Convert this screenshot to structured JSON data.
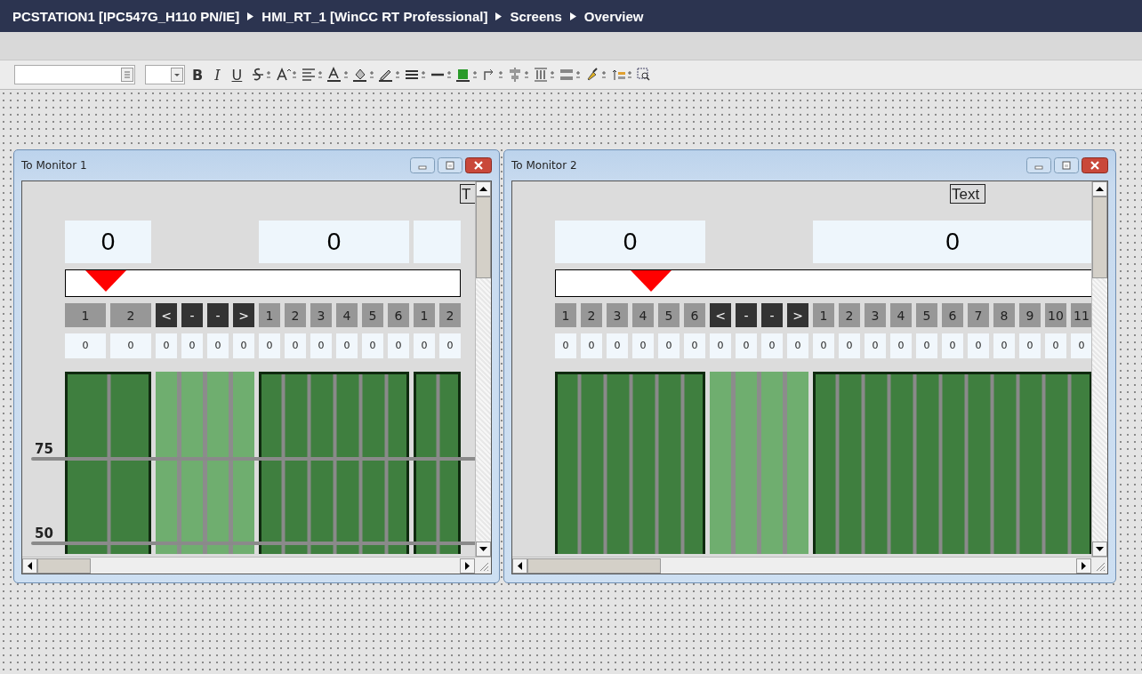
{
  "breadcrumb": [
    {
      "label": "PCSTATION1 [IPC547G_H110 PN/IE]"
    },
    {
      "label": "HMI_RT_1 [WinCC RT Professional]"
    },
    {
      "label": "Screens"
    },
    {
      "label": "Overview"
    }
  ],
  "toolbar": {
    "format_buttons": [
      "B",
      "I",
      "U"
    ]
  },
  "windows": [
    {
      "title": "To Monitor 1",
      "text_box": "T",
      "slider": {
        "level": 0.05
      },
      "scale_labels": [
        "75",
        "50"
      ],
      "groups": [
        {
          "kind": "wide",
          "display": "0",
          "cells": [
            {
              "label": "1",
              "value": "0"
            },
            {
              "label": "2",
              "value": "0"
            }
          ]
        },
        {
          "kind": "nav",
          "cells": [
            {
              "label": "<",
              "value": "0"
            },
            {
              "label": "-",
              "value": "0"
            },
            {
              "label": "-",
              "value": "0"
            },
            {
              "label": ">",
              "value": "0"
            }
          ]
        },
        {
          "kind": "slot",
          "display": "0",
          "cells": [
            {
              "label": "1",
              "value": "0"
            },
            {
              "label": "2",
              "value": "0"
            },
            {
              "label": "3",
              "value": "0"
            },
            {
              "label": "4",
              "value": "0"
            },
            {
              "label": "5",
              "value": "0"
            },
            {
              "label": "6",
              "value": "0"
            }
          ]
        },
        {
          "kind": "slot",
          "cells": [
            {
              "label": "1",
              "value": "0"
            },
            {
              "label": "2",
              "value": "0"
            }
          ]
        }
      ]
    },
    {
      "title": "To Monitor 2",
      "text_box": "Text",
      "slider": {
        "level": 0.14
      },
      "groups": [
        {
          "kind": "slot",
          "display": "0",
          "cells": [
            {
              "label": "1",
              "value": "0"
            },
            {
              "label": "2",
              "value": "0"
            },
            {
              "label": "3",
              "value": "0"
            },
            {
              "label": "4",
              "value": "0"
            },
            {
              "label": "5",
              "value": "0"
            },
            {
              "label": "6",
              "value": "0"
            }
          ]
        },
        {
          "kind": "nav",
          "cells": [
            {
              "label": "<",
              "value": "0"
            },
            {
              "label": "-",
              "value": "0"
            },
            {
              "label": "-",
              "value": "0"
            },
            {
              "label": ">",
              "value": "0"
            }
          ]
        },
        {
          "kind": "slot",
          "display": "0",
          "cells": [
            {
              "label": "1",
              "value": "0"
            },
            {
              "label": "2",
              "value": "0"
            },
            {
              "label": "3",
              "value": "0"
            },
            {
              "label": "4",
              "value": "0"
            },
            {
              "label": "5",
              "value": "0"
            },
            {
              "label": "6",
              "value": "0"
            },
            {
              "label": "7",
              "value": "0"
            },
            {
              "label": "8",
              "value": "0"
            },
            {
              "label": "9",
              "value": "0"
            },
            {
              "label": "10",
              "value": "0"
            },
            {
              "label": "11",
              "value": "0"
            }
          ]
        }
      ]
    }
  ]
}
